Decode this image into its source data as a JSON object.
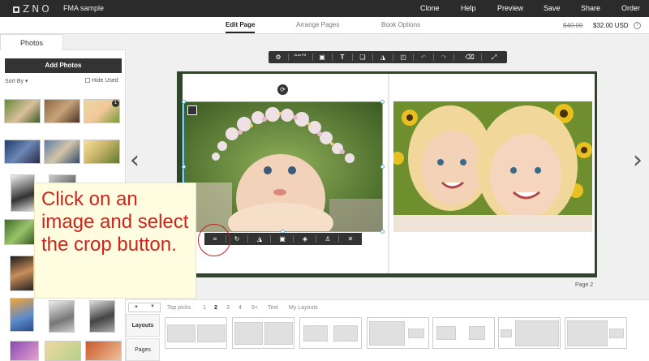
{
  "app": {
    "logo": "ZNO",
    "project": "FMA sample"
  },
  "topnav": [
    "Clone",
    "Help",
    "Preview",
    "Save",
    "Share",
    "Order"
  ],
  "subnav": {
    "tabs": [
      "Edit Page",
      "Arrange Pages",
      "Book Options"
    ],
    "active": "Edit Page",
    "price_old": "$40.00",
    "price_new": "$32.00 USD",
    "info": "?"
  },
  "sidebar": {
    "tabs": [
      "Photos",
      ""
    ],
    "add_photos": "Add Photos",
    "sort_by": "Sort By ▾",
    "hide_used": "Hide Used",
    "badge": "1"
  },
  "canvas_toolbar": {
    "autofill": "Auto Fill"
  },
  "page_label": "Page 2",
  "callout": "Click on an image and select the crop button.",
  "layouts": {
    "pager": [
      "▲",
      "▼"
    ],
    "tabs": [
      "Top picks",
      "1",
      "2",
      "3",
      "4",
      "5+",
      "Text",
      "My Layouts"
    ],
    "active_tab": "2",
    "side_tabs": [
      "Layouts",
      "Pages"
    ]
  },
  "colors": {
    "accent": "#4db8e8",
    "callout_text": "#d0231c",
    "book_cover": "#31452d",
    "topbar": "#2b2b2b"
  }
}
